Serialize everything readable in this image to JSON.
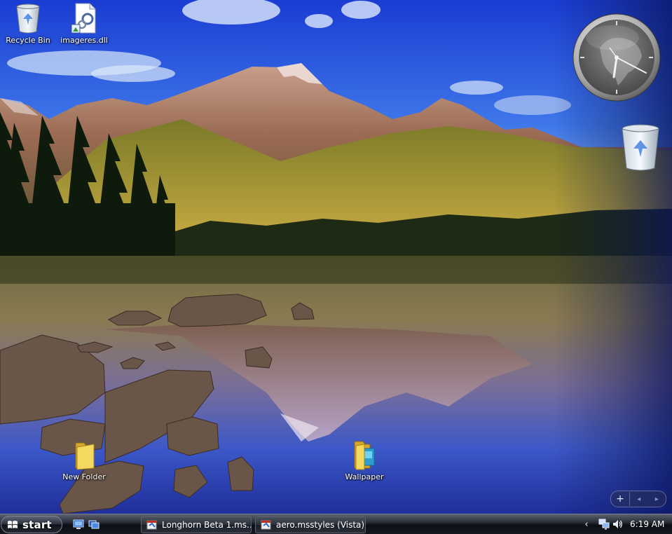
{
  "desktop": {
    "icons": [
      {
        "label": "Recycle Bin",
        "icon": "recycle-bin-icon"
      },
      {
        "label": "imageres.dll",
        "icon": "dll-file-icon"
      },
      {
        "label": "New Folder",
        "icon": "folder-icon"
      },
      {
        "label": "Wallpaper",
        "icon": "folder-icon"
      }
    ]
  },
  "sidebar": {
    "gadgets": [
      "clock-gadget",
      "recycle-bin-gadget"
    ],
    "controls": {
      "add_label": "+",
      "prev_label": "◂",
      "next_label": "▸"
    }
  },
  "taskbar": {
    "start_label": "start",
    "quick_launch": [
      "show-desktop-icon",
      "switch-windows-icon"
    ],
    "buttons": [
      {
        "label": "Longhorn Beta 1.ms...",
        "icon": "msstyles-file-icon"
      },
      {
        "label": "aero.msstyles (Vista)...",
        "icon": "msstyles-file-icon"
      }
    ],
    "tray": {
      "chevron": "‹",
      "icons": [
        "network-icon",
        "volume-icon"
      ],
      "time": "6:19 AM"
    }
  },
  "colors": {
    "taskbar_dark": "#0c0e14",
    "sky_blue": "#3b73e8",
    "folder_yellow": "#f2d04e"
  }
}
